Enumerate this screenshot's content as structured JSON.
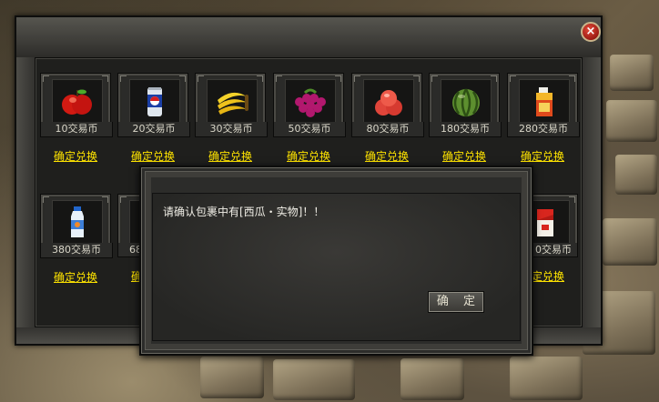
{
  "shop": {
    "redeem_label": "确定兑换",
    "items": [
      {
        "price": "10交易币",
        "icon": "apple-icon"
      },
      {
        "price": "20交易币",
        "icon": "soda-can-icon"
      },
      {
        "price": "30交易币",
        "icon": "banana-icon"
      },
      {
        "price": "50交易币",
        "icon": "grape-icon"
      },
      {
        "price": "80交易币",
        "icon": "peach-icon"
      },
      {
        "price": "180交易币",
        "icon": "watermelon-icon"
      },
      {
        "price": "280交易币",
        "icon": "juice-box-icon"
      },
      {
        "price": "380交易币",
        "icon": "water-bottle-icon"
      },
      {
        "price": "68",
        "icon": "hidden-item-icon"
      },
      {
        "price": "0交易币",
        "icon": "cigarette-pack-icon"
      }
    ]
  },
  "dialog": {
    "message": "请确认包裹中有[西瓜・实物]！！",
    "confirm_label": "确 定"
  },
  "close_glyph": "×"
}
